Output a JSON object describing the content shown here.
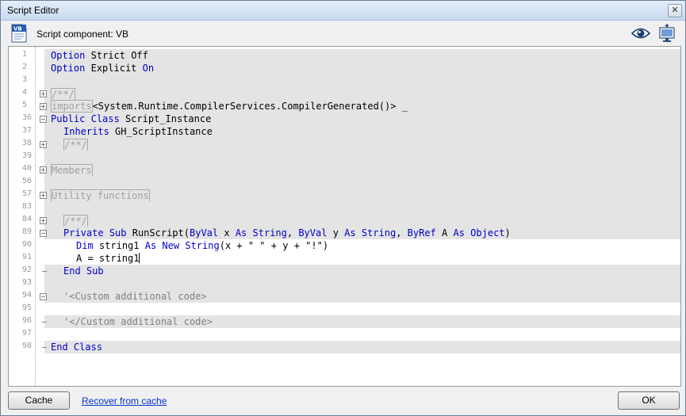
{
  "window": {
    "title": "Script Editor",
    "close_glyph": "✕"
  },
  "header": {
    "component_label": "Script component: VB",
    "icons": [
      "vb-script-icon",
      "eye-preview-icon",
      "monitor-dock-icon"
    ]
  },
  "editor": {
    "lines": [
      {
        "n": "1",
        "text": "Option Strict Off"
      },
      {
        "n": "2",
        "text": "Option Explicit On"
      },
      {
        "n": "3",
        "text": ""
      },
      {
        "n": "4",
        "text": "/**/"
      },
      {
        "n": "5",
        "text": "imports<System.Runtime.CompilerServices.CompilerGenerated()> _"
      },
      {
        "n": "36",
        "text": "Public Class Script_Instance"
      },
      {
        "n": "37",
        "text": "Inherits GH_ScriptInstance"
      },
      {
        "n": "38",
        "text": "/**/"
      },
      {
        "n": "39",
        "text": ""
      },
      {
        "n": "40",
        "text": "Members"
      },
      {
        "n": "56",
        "text": ""
      },
      {
        "n": "57",
        "text": "Utility functions"
      },
      {
        "n": "83",
        "text": ""
      },
      {
        "n": "84",
        "text": "/**/"
      },
      {
        "n": "89",
        "text": "Private Sub RunScript(ByVal x As String, ByVal y As String, ByRef A As Object)"
      },
      {
        "n": "90",
        "text": "Dim string1 As New String(x + \" \" + y + \"!\")"
      },
      {
        "n": "91",
        "text": "A = string1"
      },
      {
        "n": "92",
        "text": "End Sub"
      },
      {
        "n": "93",
        "text": ""
      },
      {
        "n": "94",
        "text": "'<Custom additional code>"
      },
      {
        "n": "95",
        "text": ""
      },
      {
        "n": "96",
        "text": "'</Custom additional code>"
      },
      {
        "n": "97",
        "text": ""
      },
      {
        "n": "98",
        "text": "End Class"
      }
    ]
  },
  "footer": {
    "cache_label": "Cache",
    "recover_label": "Recover from cache",
    "ok_label": "OK"
  },
  "colors": {
    "keyword": "#0000c8",
    "string": "#a31515",
    "comment": "#808080",
    "code_bg": "#e4e4e4"
  }
}
